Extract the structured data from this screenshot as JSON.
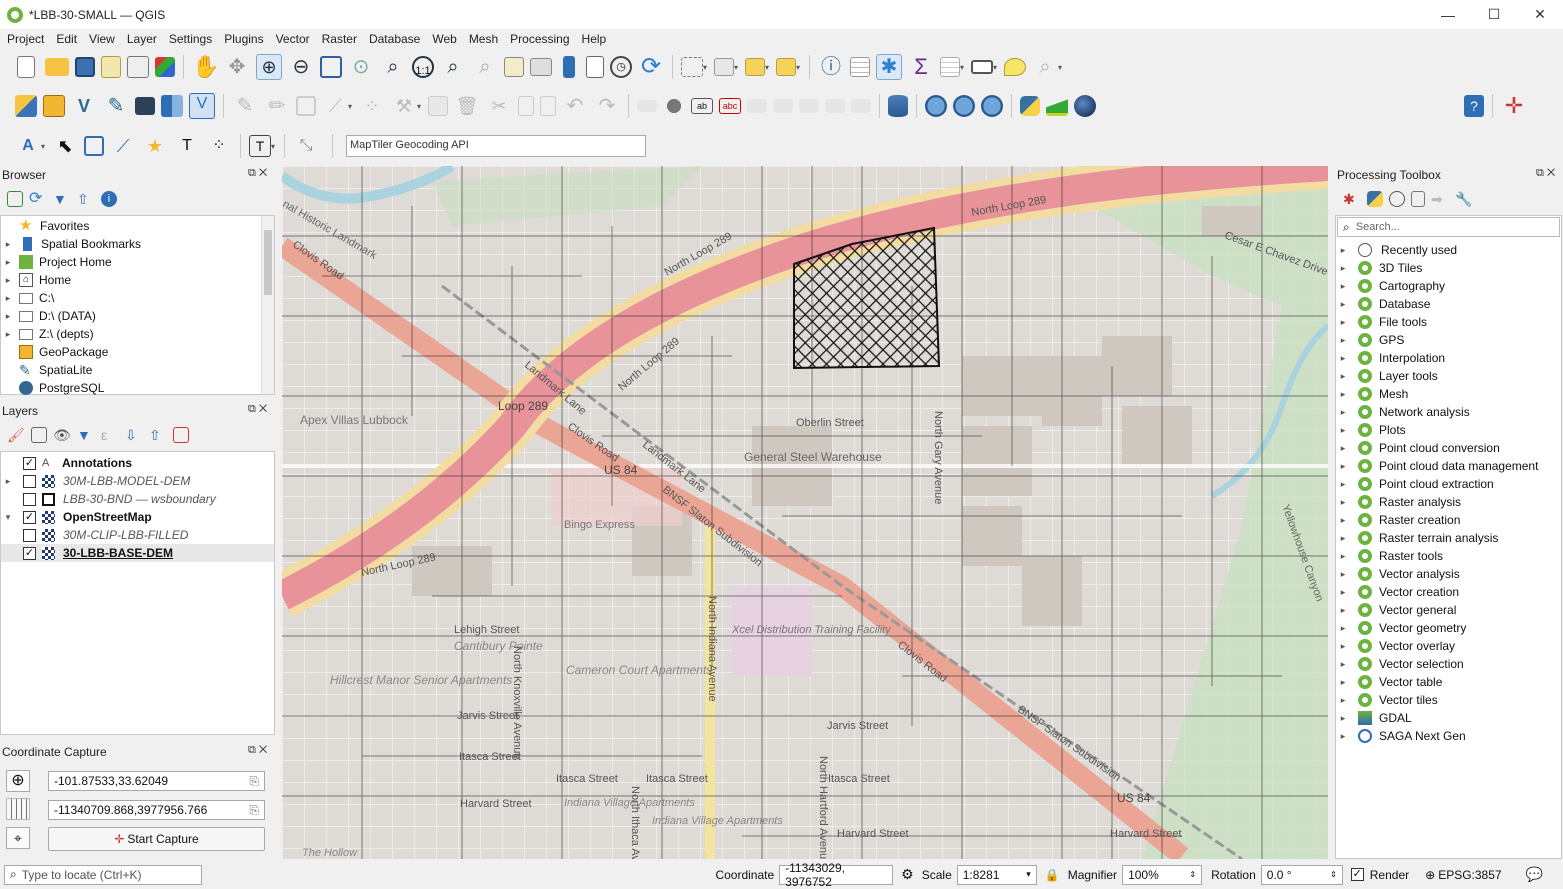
{
  "window": {
    "title": "*LBB-30-SMALL — QGIS",
    "minimize": "—",
    "maximize": "☐",
    "close": "✕"
  },
  "menu": [
    "Project",
    "Edit",
    "View",
    "Layer",
    "Settings",
    "Plugins",
    "Vector",
    "Raster",
    "Database",
    "Web",
    "Mesh",
    "Processing",
    "Help"
  ],
  "geocoder": {
    "placeholder": "MapTiler Geocoding API"
  },
  "browser": {
    "title": "Browser",
    "items": [
      {
        "label": "Favorites",
        "icon": "star-icon"
      },
      {
        "label": "Spatial Bookmarks",
        "icon": "bookmark-icon"
      },
      {
        "label": "Project Home",
        "icon": "project-home-icon"
      },
      {
        "label": "Home",
        "icon": "home-icon"
      },
      {
        "label": "C:\\",
        "icon": "folder-icon"
      },
      {
        "label": "D:\\ (DATA)",
        "icon": "folder-icon"
      },
      {
        "label": "Z:\\ (depts)",
        "icon": "folder-icon"
      },
      {
        "label": "GeoPackage",
        "icon": "geopackage-icon"
      },
      {
        "label": "SpatiaLite",
        "icon": "spatialite-icon"
      },
      {
        "label": "PostgreSQL",
        "icon": "postgresql-icon"
      }
    ]
  },
  "layers": {
    "title": "Layers",
    "items": [
      {
        "label": "Annotations",
        "checked": true
      },
      {
        "label": "30M-LBB-MODEL-DEM",
        "checked": false
      },
      {
        "label": "LBB-30-BND — wsboundary",
        "checked": false
      },
      {
        "label": "OpenStreetMap",
        "checked": true
      },
      {
        "label": "30M-CLIP-LBB-FILLED",
        "checked": false
      },
      {
        "label": "30-LBB-BASE-DEM",
        "checked": true
      }
    ]
  },
  "coord_capture": {
    "title": "Coordinate Capture",
    "geo": "-101.87533,33.62049",
    "proj": "-11340709.868,3977956.766",
    "start_label": "Start Capture"
  },
  "toolbox": {
    "title": "Processing Toolbox",
    "search_placeholder": "Search...",
    "items": [
      "Recently used",
      "3D Tiles",
      "Cartography",
      "Database",
      "File tools",
      "GPS",
      "Interpolation",
      "Layer tools",
      "Mesh",
      "Network analysis",
      "Plots",
      "Point cloud conversion",
      "Point cloud data management",
      "Point cloud extraction",
      "Raster analysis",
      "Raster creation",
      "Raster terrain analysis",
      "Raster tools",
      "Vector analysis",
      "Vector creation",
      "Vector general",
      "Vector geometry",
      "Vector overlay",
      "Vector selection",
      "Vector table",
      "Vector tiles",
      "GDAL",
      "SAGA Next Gen"
    ]
  },
  "map_labels": [
    "North Loop 289",
    "North Loop 289",
    "North Loop 289",
    "North Loop 289",
    "Loop 289",
    "Clovis Road",
    "Clovis Road",
    "Clovis Road",
    "Landmark Lane",
    "Landmark Lane",
    "US 84",
    "US 84",
    "Oberlin Street",
    "North Gary Avenue",
    "General Steel Warehouse",
    "Bingo Express",
    "Xcel Distribution Training Facility",
    "Apex Villas Lubbock",
    "Lehigh Street",
    "Cantibury Pointe",
    "Cameron Court Apartments",
    "Hillcrest Manor Senior Apartments",
    "Jarvis Street",
    "Jarvis Street",
    "Itasca Street",
    "Itasca Street",
    "Itasca Street",
    "Itasca Street",
    "Harvard Street",
    "Harvard Street",
    "Harvard Street",
    "Indiana Village Apartments",
    "Indiana Village Apartments",
    "North Knoxville Avenue",
    "North Indiana Avenue",
    "North Ithaca Avenue",
    "North Hartford Avenue",
    "BNSF Slaton Subdivision",
    "BNSF Slaton Subdivision",
    "Cesar E Chavez Drive",
    "Yellowhouse Canyon",
    "The Hollow",
    "nal Historic Landmark"
  ],
  "status": {
    "locate_placeholder": "Type to locate (Ctrl+K)",
    "coordinate_label": "Coordinate",
    "coordinate": "-11343029, 3976752",
    "scale_label": "Scale",
    "scale": "1:8281",
    "magnifier_label": "Magnifier",
    "magnifier": "100%",
    "rotation_label": "Rotation",
    "rotation": "0.0 °",
    "render_label": "Render",
    "crs": "EPSG:3857"
  },
  "colors": {
    "qgis_green": "#6cb33f",
    "motorway": "#e8929a",
    "trunk_casing": "#f2dca2",
    "park": "#c8e8c0",
    "water": "#aad3df"
  }
}
